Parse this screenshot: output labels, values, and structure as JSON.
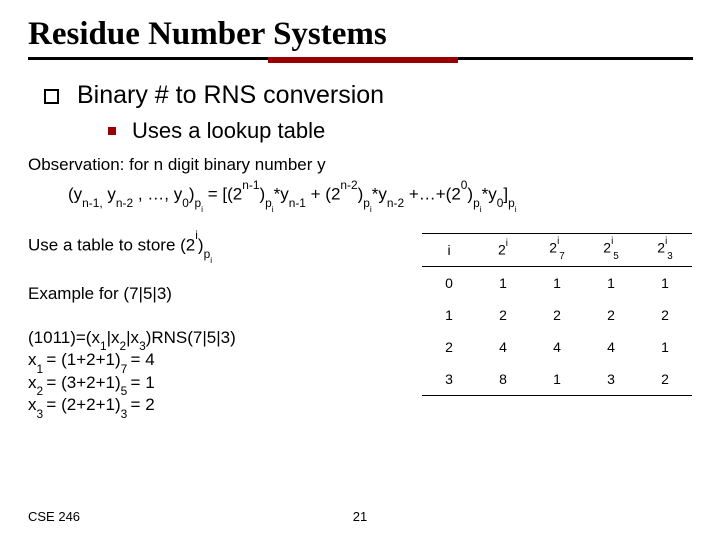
{
  "title": "Residue Number Systems",
  "bullet1": "Binary # to RNS conversion",
  "bullet2": "Uses a lookup table",
  "obs_label": "Observation: for n digit binary number y",
  "use_table": "Use a table to store (2",
  "use_table_tail": ")",
  "example_for": "Example for (7|5|3)",
  "example_block": {
    "l1_a": "(1011)=(x",
    "l1_b": "|x",
    "l1_c": "|x",
    "l1_d": ")RNS(7|5|3)",
    "l2_a": "x",
    "l2_b": "= (1+2+1)",
    "l2_c": "= 4",
    "l3_a": "x",
    "l3_b": "= (3+2+1)",
    "l3_c": "= 1",
    "l4_a": "x",
    "l4_b": "= (2+2+1)",
    "l4_c": "= 2"
  },
  "table": {
    "head": [
      "i",
      "2i",
      "2i7",
      "2i5",
      "2i3"
    ],
    "rows": [
      [
        "0",
        "1",
        "1",
        "1",
        "1"
      ],
      [
        "1",
        "2",
        "2",
        "2",
        "2"
      ],
      [
        "2",
        "4",
        "4",
        "4",
        "1"
      ],
      [
        "3",
        "8",
        "1",
        "3",
        "2"
      ]
    ]
  },
  "footer_course": "CSE 246",
  "footer_page": "21",
  "formula": {
    "pre": "(y",
    "s_nm1": "n-1,",
    "mid1": "y",
    "s_nm2": "n-2",
    "mid2": ", …, y",
    "s_0": "0",
    "close": ")",
    "sub_pi": "p",
    "sub_i": "i",
    "eq": "= [(2",
    "sup_nm1": "n-1",
    "r1": ")",
    "star": "*y",
    "sup_nm2": "n-2",
    "plus": "+ (2",
    "plusdots": "+…+(2",
    "sup_0": "0",
    "close_sq": "]"
  }
}
